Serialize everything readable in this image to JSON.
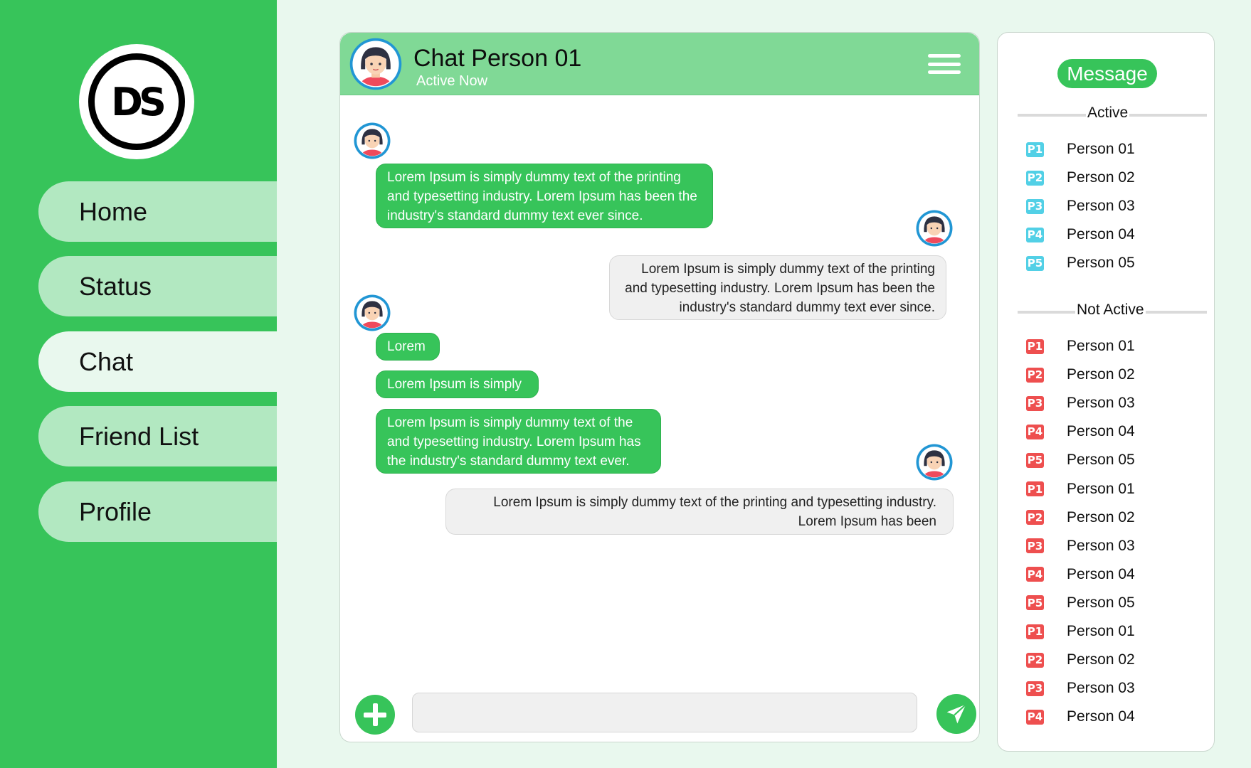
{
  "app": {
    "logo_text": "DS"
  },
  "nav": [
    {
      "label": "Home"
    },
    {
      "label": "Status"
    },
    {
      "label": "Chat"
    },
    {
      "label": "Friend List"
    },
    {
      "label": "Profile"
    }
  ],
  "chat": {
    "name": "Chat Person 01",
    "status": "Active Now",
    "messages": [
      {
        "type": "in",
        "text": "Lorem Ipsum is simply dummy text of the printing and typesetting industry. Lorem Ipsum has been the industry's standard dummy text ever since."
      },
      {
        "type": "out",
        "text": "Lorem Ipsum is simply dummy text of the printing and typesetting industry. Lorem Ipsum has been the industry's standard dummy text ever since."
      },
      {
        "type": "in",
        "text": "Lorem"
      },
      {
        "type": "in",
        "text": "Lorem Ipsum is simply"
      },
      {
        "type": "in",
        "text": "Lorem Ipsum is simply dummy text of the and typesetting industry. Lorem Ipsum has the industry's standard dummy text ever."
      },
      {
        "type": "out",
        "text": "Lorem Ipsum is simply dummy text of the printing and typesetting industry. Lorem Ipsum has been"
      }
    ],
    "input": {
      "value": "",
      "placeholder": ""
    }
  },
  "contacts": {
    "title": "Message",
    "active_label": "Active",
    "inactive_label": "Not Active",
    "active": [
      {
        "badge": "P1",
        "name": "Person 01"
      },
      {
        "badge": "P2",
        "name": "Person 02"
      },
      {
        "badge": "P3",
        "name": "Person 03"
      },
      {
        "badge": "P4",
        "name": "Person 04"
      },
      {
        "badge": "P5",
        "name": "Person 05"
      }
    ],
    "inactive": [
      {
        "badge": "P1",
        "name": "Person 01"
      },
      {
        "badge": "P2",
        "name": "Person 02"
      },
      {
        "badge": "P3",
        "name": "Person 03"
      },
      {
        "badge": "P4",
        "name": "Person 04"
      },
      {
        "badge": "P5",
        "name": "Person 05"
      },
      {
        "badge": "P1",
        "name": "Person 01"
      },
      {
        "badge": "P2",
        "name": "Person 02"
      },
      {
        "badge": "P3",
        "name": "Person 03"
      },
      {
        "badge": "P4",
        "name": "Person 04"
      },
      {
        "badge": "P5",
        "name": "Person 05"
      },
      {
        "badge": "P1",
        "name": "Person 01"
      },
      {
        "badge": "P2",
        "name": "Person 02"
      },
      {
        "badge": "P3",
        "name": "Person 03"
      },
      {
        "badge": "P4",
        "name": "Person 04"
      }
    ]
  },
  "colors": {
    "primary_green": "#37c45a",
    "header_green": "#80d996",
    "nav_item": "#b2e8c1",
    "background": "#e9f8ee",
    "active_badge": "#52d0e6",
    "inactive_badge": "#ee4f4f"
  },
  "icons": {
    "menu": "hamburger-icon",
    "add": "plus-icon",
    "send": "paper-plane-icon",
    "avatar": "woman-avatar-icon"
  }
}
